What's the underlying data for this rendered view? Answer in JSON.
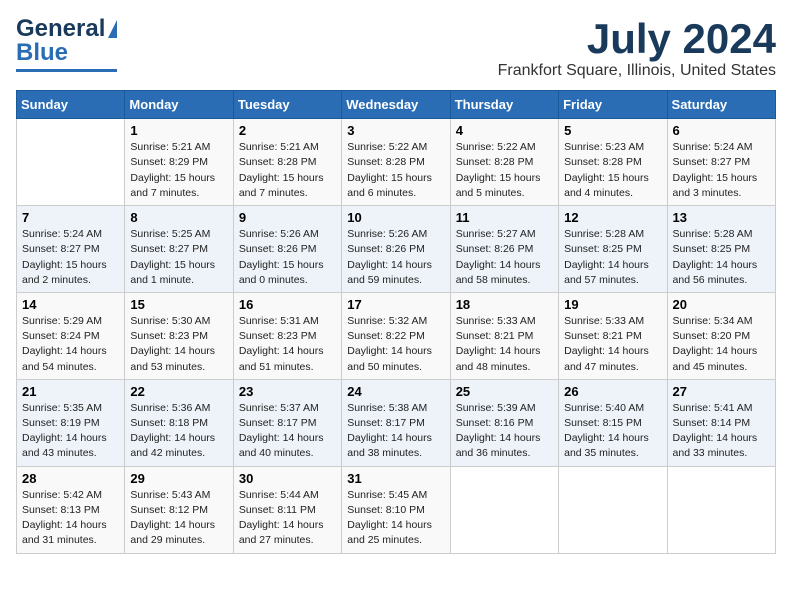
{
  "header": {
    "logo_line1": "General",
    "logo_line2": "Blue",
    "month": "July 2024",
    "location": "Frankfort Square, Illinois, United States"
  },
  "days_of_week": [
    "Sunday",
    "Monday",
    "Tuesday",
    "Wednesday",
    "Thursday",
    "Friday",
    "Saturday"
  ],
  "weeks": [
    [
      {
        "day": "",
        "info": ""
      },
      {
        "day": "1",
        "info": "Sunrise: 5:21 AM\nSunset: 8:29 PM\nDaylight: 15 hours\nand 7 minutes."
      },
      {
        "day": "2",
        "info": "Sunrise: 5:21 AM\nSunset: 8:28 PM\nDaylight: 15 hours\nand 7 minutes."
      },
      {
        "day": "3",
        "info": "Sunrise: 5:22 AM\nSunset: 8:28 PM\nDaylight: 15 hours\nand 6 minutes."
      },
      {
        "day": "4",
        "info": "Sunrise: 5:22 AM\nSunset: 8:28 PM\nDaylight: 15 hours\nand 5 minutes."
      },
      {
        "day": "5",
        "info": "Sunrise: 5:23 AM\nSunset: 8:28 PM\nDaylight: 15 hours\nand 4 minutes."
      },
      {
        "day": "6",
        "info": "Sunrise: 5:24 AM\nSunset: 8:27 PM\nDaylight: 15 hours\nand 3 minutes."
      }
    ],
    [
      {
        "day": "7",
        "info": "Sunrise: 5:24 AM\nSunset: 8:27 PM\nDaylight: 15 hours\nand 2 minutes."
      },
      {
        "day": "8",
        "info": "Sunrise: 5:25 AM\nSunset: 8:27 PM\nDaylight: 15 hours\nand 1 minute."
      },
      {
        "day": "9",
        "info": "Sunrise: 5:26 AM\nSunset: 8:26 PM\nDaylight: 15 hours\nand 0 minutes."
      },
      {
        "day": "10",
        "info": "Sunrise: 5:26 AM\nSunset: 8:26 PM\nDaylight: 14 hours\nand 59 minutes."
      },
      {
        "day": "11",
        "info": "Sunrise: 5:27 AM\nSunset: 8:26 PM\nDaylight: 14 hours\nand 58 minutes."
      },
      {
        "day": "12",
        "info": "Sunrise: 5:28 AM\nSunset: 8:25 PM\nDaylight: 14 hours\nand 57 minutes."
      },
      {
        "day": "13",
        "info": "Sunrise: 5:28 AM\nSunset: 8:25 PM\nDaylight: 14 hours\nand 56 minutes."
      }
    ],
    [
      {
        "day": "14",
        "info": "Sunrise: 5:29 AM\nSunset: 8:24 PM\nDaylight: 14 hours\nand 54 minutes."
      },
      {
        "day": "15",
        "info": "Sunrise: 5:30 AM\nSunset: 8:23 PM\nDaylight: 14 hours\nand 53 minutes."
      },
      {
        "day": "16",
        "info": "Sunrise: 5:31 AM\nSunset: 8:23 PM\nDaylight: 14 hours\nand 51 minutes."
      },
      {
        "day": "17",
        "info": "Sunrise: 5:32 AM\nSunset: 8:22 PM\nDaylight: 14 hours\nand 50 minutes."
      },
      {
        "day": "18",
        "info": "Sunrise: 5:33 AM\nSunset: 8:21 PM\nDaylight: 14 hours\nand 48 minutes."
      },
      {
        "day": "19",
        "info": "Sunrise: 5:33 AM\nSunset: 8:21 PM\nDaylight: 14 hours\nand 47 minutes."
      },
      {
        "day": "20",
        "info": "Sunrise: 5:34 AM\nSunset: 8:20 PM\nDaylight: 14 hours\nand 45 minutes."
      }
    ],
    [
      {
        "day": "21",
        "info": "Sunrise: 5:35 AM\nSunset: 8:19 PM\nDaylight: 14 hours\nand 43 minutes."
      },
      {
        "day": "22",
        "info": "Sunrise: 5:36 AM\nSunset: 8:18 PM\nDaylight: 14 hours\nand 42 minutes."
      },
      {
        "day": "23",
        "info": "Sunrise: 5:37 AM\nSunset: 8:17 PM\nDaylight: 14 hours\nand 40 minutes."
      },
      {
        "day": "24",
        "info": "Sunrise: 5:38 AM\nSunset: 8:17 PM\nDaylight: 14 hours\nand 38 minutes."
      },
      {
        "day": "25",
        "info": "Sunrise: 5:39 AM\nSunset: 8:16 PM\nDaylight: 14 hours\nand 36 minutes."
      },
      {
        "day": "26",
        "info": "Sunrise: 5:40 AM\nSunset: 8:15 PM\nDaylight: 14 hours\nand 35 minutes."
      },
      {
        "day": "27",
        "info": "Sunrise: 5:41 AM\nSunset: 8:14 PM\nDaylight: 14 hours\nand 33 minutes."
      }
    ],
    [
      {
        "day": "28",
        "info": "Sunrise: 5:42 AM\nSunset: 8:13 PM\nDaylight: 14 hours\nand 31 minutes."
      },
      {
        "day": "29",
        "info": "Sunrise: 5:43 AM\nSunset: 8:12 PM\nDaylight: 14 hours\nand 29 minutes."
      },
      {
        "day": "30",
        "info": "Sunrise: 5:44 AM\nSunset: 8:11 PM\nDaylight: 14 hours\nand 27 minutes."
      },
      {
        "day": "31",
        "info": "Sunrise: 5:45 AM\nSunset: 8:10 PM\nDaylight: 14 hours\nand 25 minutes."
      },
      {
        "day": "",
        "info": ""
      },
      {
        "day": "",
        "info": ""
      },
      {
        "day": "",
        "info": ""
      }
    ]
  ]
}
